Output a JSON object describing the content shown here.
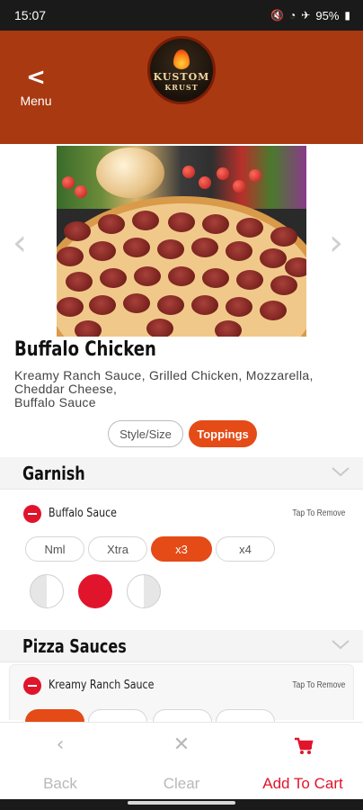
{
  "status_bar": {
    "time": "15:07",
    "battery": "95%"
  },
  "header": {
    "back_label": "Menu",
    "logo_line1": "KUSTOM",
    "logo_line2": "KRUST"
  },
  "item": {
    "title": "Buffalo Chicken",
    "description": "Kreamy Ranch Sauce, Grilled Chicken, Mozzarella, Cheddar Cheese,\nBuffalo Sauce"
  },
  "tabs": {
    "style_size": "Style/Size",
    "toppings": "Toppings",
    "active": "Toppings"
  },
  "sections": [
    {
      "title": "Garnish",
      "sauce": {
        "name": "Buffalo Sauce",
        "hint": "Tap To Remove"
      },
      "amounts": [
        "Nml",
        "Xtra",
        "x3",
        "x4"
      ],
      "selected_amount": "x3",
      "portion_selected": "whole"
    },
    {
      "title": "Pizza Sauces",
      "sauce": {
        "name": "Kreamy Ranch Sauce",
        "hint": "Tap To Remove"
      }
    }
  ],
  "bottom_bar": {
    "back": "Back",
    "clear": "Clear",
    "add_to_cart": "Add To Cart"
  },
  "colors": {
    "header": "#a93911",
    "accent": "#e44b17",
    "remove": "#e0142b"
  }
}
